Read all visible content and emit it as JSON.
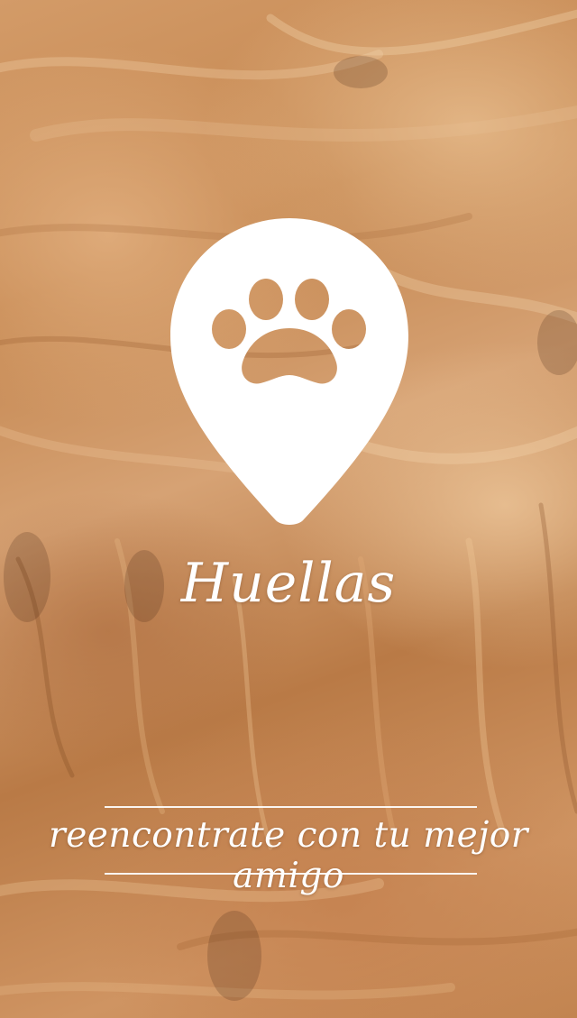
{
  "screen": {
    "background": "fur-photo-background",
    "colors": {
      "foreground": "#ffffff",
      "fur_mid": "#c98f5a"
    }
  },
  "logo": {
    "icon": "paw-location-pin-icon"
  },
  "app": {
    "title": "Huellas",
    "tagline": "reencontrate con tu mejor amigo"
  }
}
